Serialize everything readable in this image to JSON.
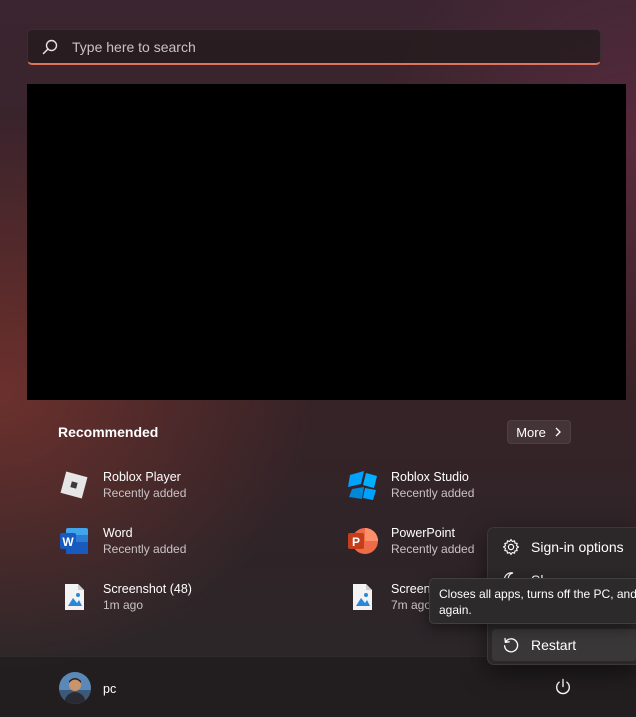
{
  "search": {
    "placeholder": "Type here to search",
    "icon": "search-icon"
  },
  "recommended": {
    "title": "Recommended",
    "more_label": "More",
    "items": [
      {
        "name": "Roblox Player",
        "sub": "Recently added",
        "icon": "roblox-player-icon"
      },
      {
        "name": "Roblox Studio",
        "sub": "Recently added",
        "icon": "roblox-studio-icon"
      },
      {
        "name": "Word",
        "sub": "Recently added",
        "icon": "word-icon"
      },
      {
        "name": "PowerPoint",
        "sub": "Recently added",
        "icon": "powerpoint-icon"
      },
      {
        "name": "Screenshot (48)",
        "sub": "1m ago",
        "icon": "image-file-icon"
      },
      {
        "name": "Screens",
        "sub": "7m ago",
        "icon": "image-file-icon"
      }
    ]
  },
  "user": {
    "name": "pc"
  },
  "power_menu": {
    "items": [
      {
        "label": "Sign-in options",
        "icon": "gear-icon"
      },
      {
        "label": "Sl",
        "icon": "sleep-icon"
      },
      {
        "label": "Restart",
        "icon": "restart-icon"
      }
    ]
  },
  "tooltip": {
    "line1": "Closes all apps, turns off the PC, and",
    "line2": "again."
  },
  "colors": {
    "search_accent": "#e0735c",
    "word_blue": "#185abd",
    "powerpoint_orange": "#d35230",
    "roblox_studio_blue": "#00a2ff"
  }
}
